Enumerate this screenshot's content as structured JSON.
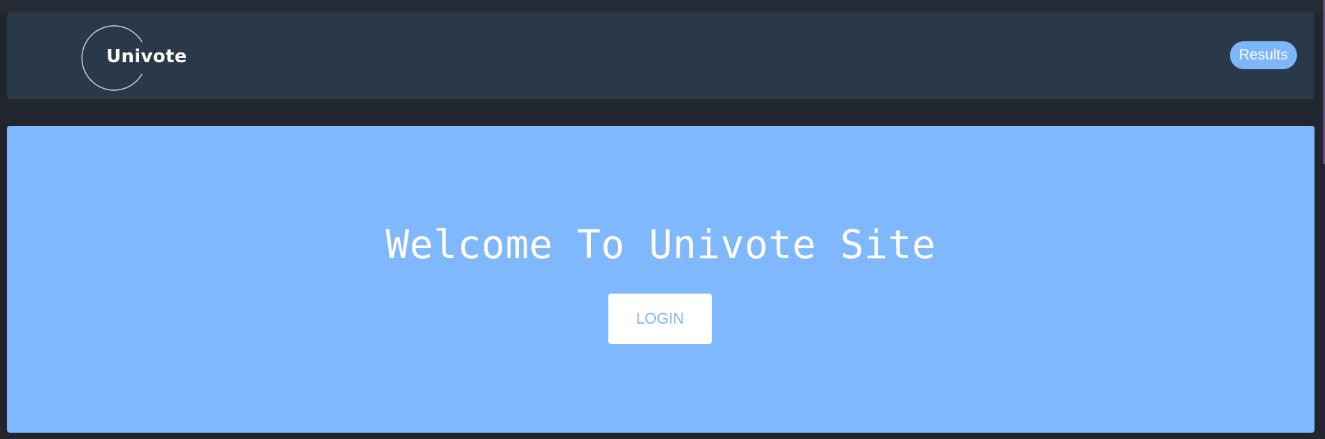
{
  "navbar": {
    "logo_text": "Univote",
    "results_label": "Results"
  },
  "hero": {
    "title": "Welcome To Univote Site",
    "login_label": "LOGIN"
  },
  "colors": {
    "navbar_bg": "#2a3949",
    "hero_bg": "#7fb8fd",
    "accent": "#7eb6fb",
    "page_bg": "#20252e"
  }
}
